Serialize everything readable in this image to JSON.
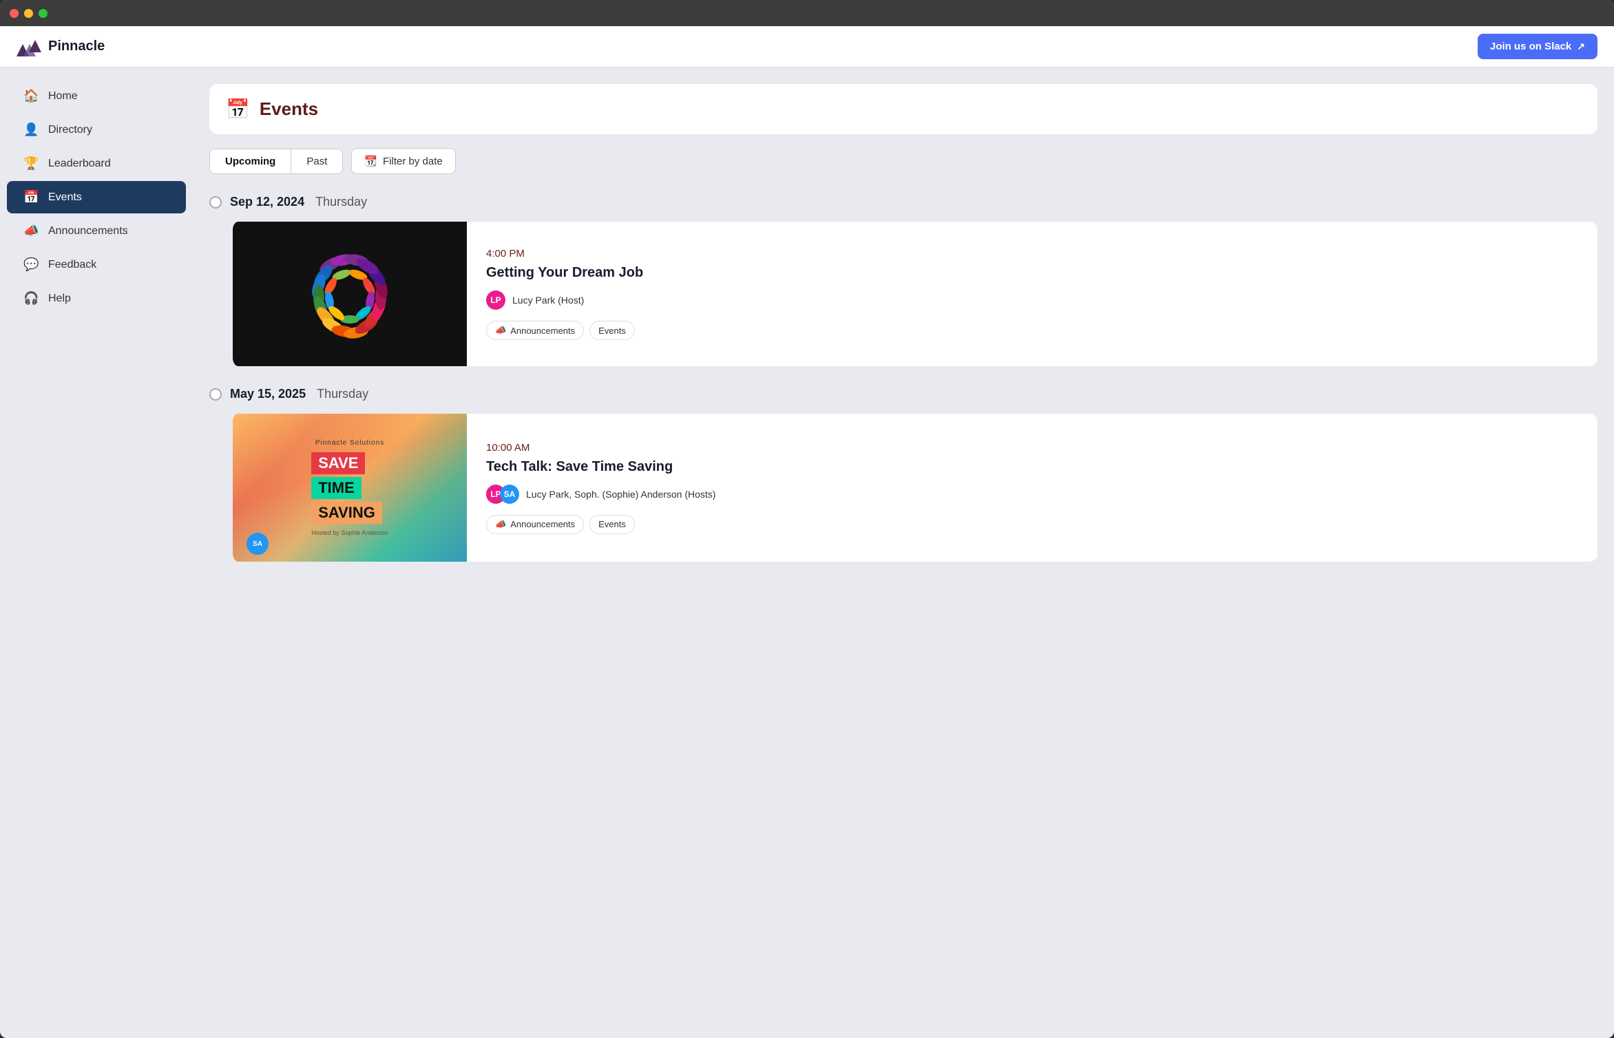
{
  "titlebar": {
    "buttons": [
      "close",
      "minimize",
      "maximize"
    ]
  },
  "header": {
    "logo_text": "Pinnacle",
    "slack_button_label": "Join us on Slack"
  },
  "sidebar": {
    "items": [
      {
        "id": "home",
        "label": "Home",
        "icon": "🏠"
      },
      {
        "id": "directory",
        "label": "Directory",
        "icon": "👤"
      },
      {
        "id": "leaderboard",
        "label": "Leaderboard",
        "icon": "🏆"
      },
      {
        "id": "events",
        "label": "Events",
        "icon": "📅",
        "active": true
      },
      {
        "id": "announcements",
        "label": "Announcements",
        "icon": "📣"
      },
      {
        "id": "feedback",
        "label": "Feedback",
        "icon": "💬"
      },
      {
        "id": "help",
        "label": "Help",
        "icon": "🎧"
      }
    ]
  },
  "main": {
    "page_title": "Events",
    "tabs": [
      {
        "id": "upcoming",
        "label": "Upcoming",
        "active": true
      },
      {
        "id": "past",
        "label": "Past",
        "active": false
      }
    ],
    "filter_button_label": "Filter by date",
    "events": [
      {
        "date": "Sep 12, 2024",
        "day": "Thursday",
        "time": "4:00 PM",
        "title": "Getting Your Dream Job",
        "host": "Lucy Park (Host)",
        "hosts": [
          "LP"
        ],
        "tags": [
          "Announcements",
          "Events"
        ]
      },
      {
        "date": "May 15, 2025",
        "day": "Thursday",
        "time": "10:00 AM",
        "title": "Tech Talk: Save Time Saving",
        "host": "Lucy Park, Soph. (Sophie) Anderson (Hosts)",
        "hosts": [
          "LP",
          "SA"
        ],
        "tags": [
          "Announcements",
          "Events"
        ]
      }
    ]
  }
}
